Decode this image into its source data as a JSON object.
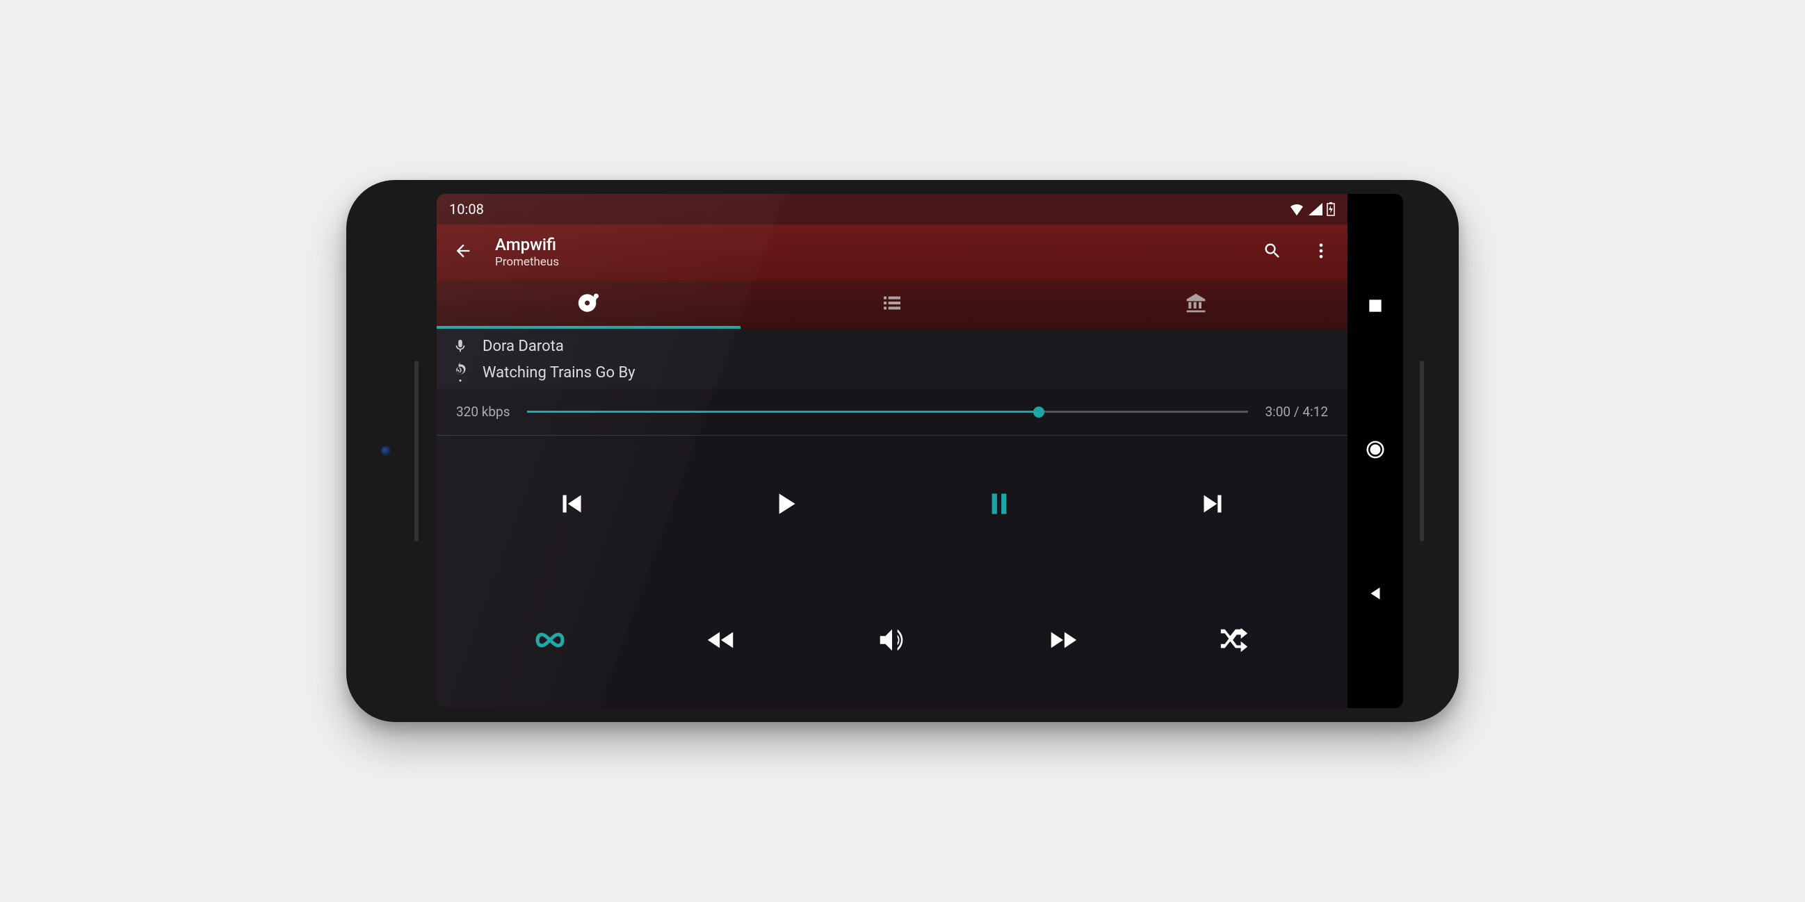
{
  "status": {
    "time": "10:08"
  },
  "appbar": {
    "title": "Ampwifi",
    "subtitle": "Prometheus"
  },
  "track": {
    "artist": "Dora Darota",
    "title": "Watching Trains Go By",
    "bitrate": "320 kbps",
    "elapsed": "3:00",
    "total": "4:12",
    "progress_percent": 71
  },
  "colors": {
    "accent": "#1ba7a7",
    "appbar": "#6b1a1a"
  },
  "tabs": {
    "active_index": 0,
    "items": [
      "now-playing",
      "playlist",
      "library"
    ]
  }
}
